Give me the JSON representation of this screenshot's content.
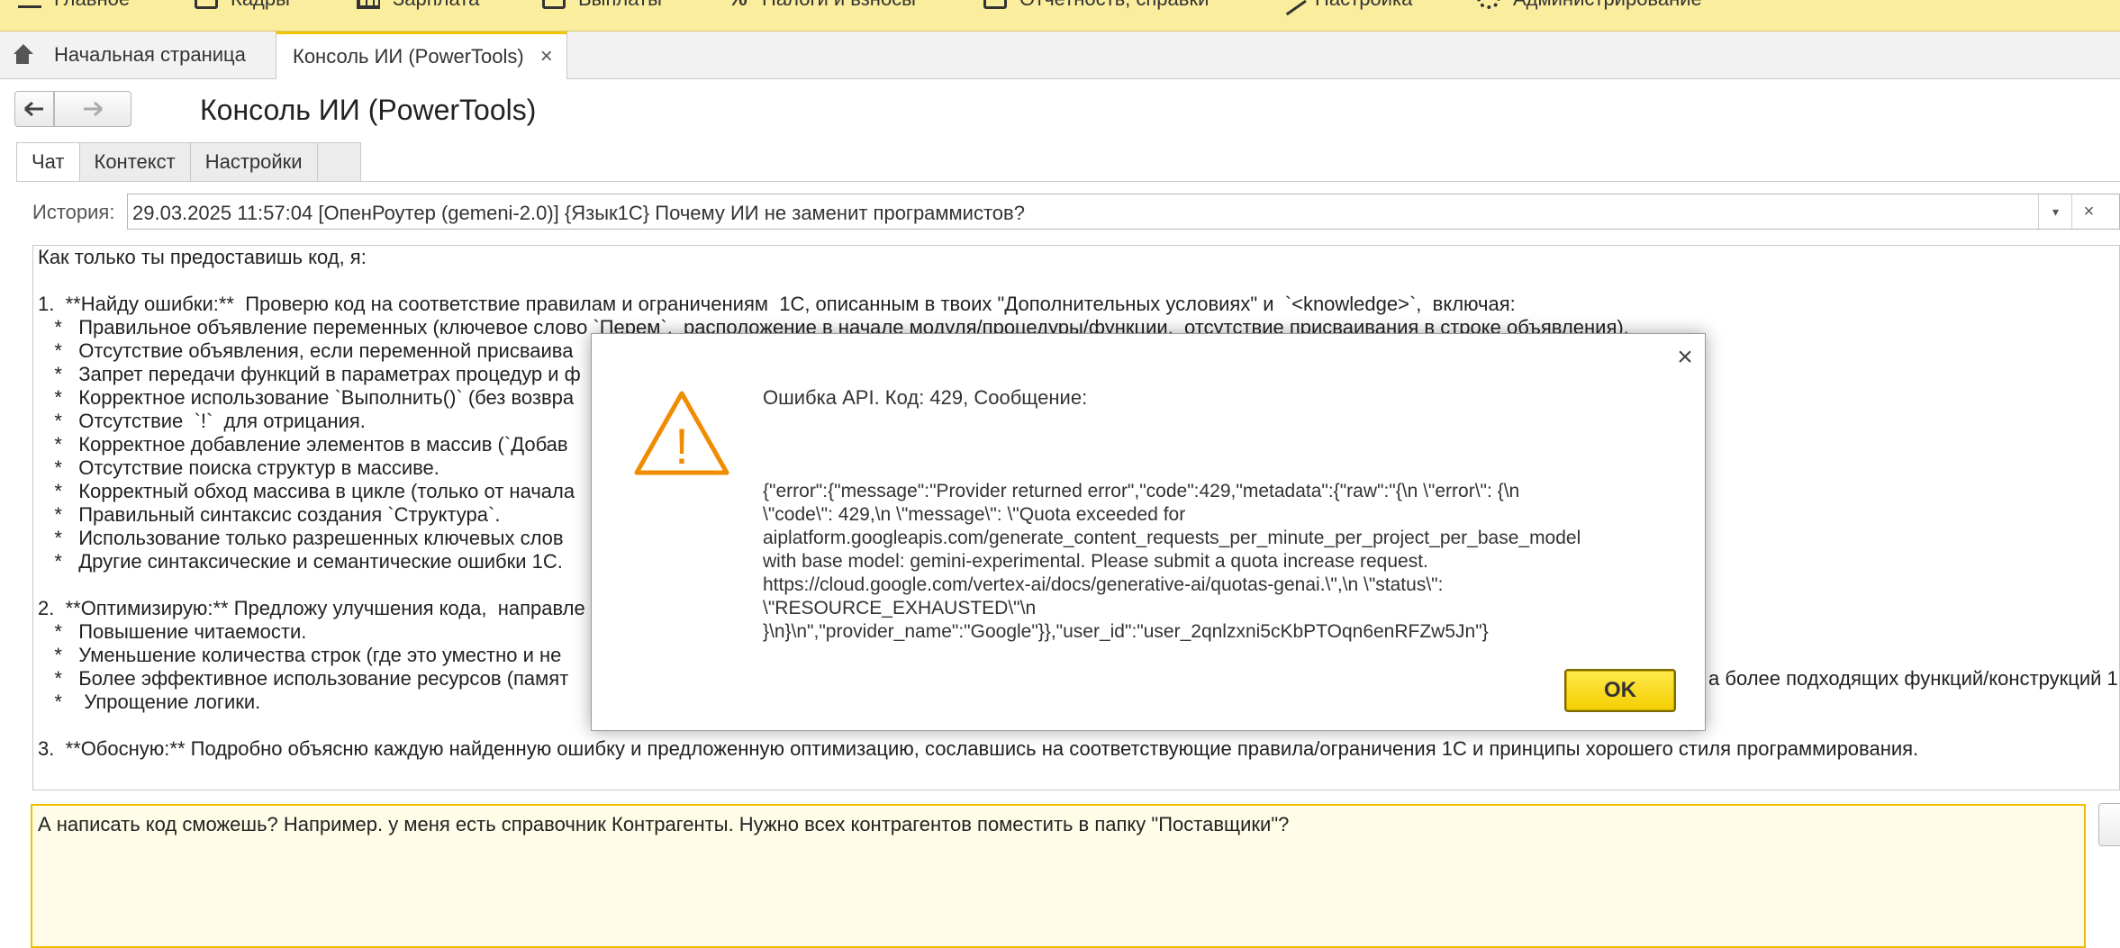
{
  "top_menu": [
    {
      "label": "Главное",
      "icon": "menu-lines-icon"
    },
    {
      "label": "Кадры",
      "icon": "people-icon"
    },
    {
      "label": "Зарплата",
      "icon": "calculator-icon"
    },
    {
      "label": "Выплаты",
      "icon": "wallet-icon"
    },
    {
      "label": "Налоги и взносы",
      "icon": "percent-icon"
    },
    {
      "label": "Отчетность, справки",
      "icon": "report-icon"
    },
    {
      "label": "Настройка",
      "icon": "wrench-icon"
    },
    {
      "label": "Администрирование",
      "icon": "gear-icon"
    }
  ],
  "tabs": {
    "home": "Начальная страница",
    "active": "Консоль ИИ (PowerTools)",
    "close_glyph": "×"
  },
  "header": {
    "back_glyph": "🡐",
    "forward_glyph": "🡒",
    "title": "Консоль ИИ (PowerTools)"
  },
  "form_tabs": [
    "Чат",
    "Контекст",
    "Настройки"
  ],
  "history": {
    "label": "История:",
    "value": "29.03.2025 11:57:04 [ОпенРоутер (gemeni-2.0)] {Язык1С} Почему ИИ не заменит программистов?",
    "dropdown_glyph": "▾",
    "clear_glyph": "×"
  },
  "response_lines": [
    "Как только ты предоставишь код, я:",
    "",
    "1.  **Найду ошибки:**  Проверю код на соответствие правилам и ограничениям  1С, описанным в твоих \"Дополнительных условиях\" и  `<knowledge>`,  включая:",
    "   *   Правильное объявление переменных (ключевое слово `Перем`,  расположение в начале модуля/процедуры/функции,  отсутствие присваивания в строке объявления).",
    "   *   Отсутствие объявления, если переменной присваива",
    "   *   Запрет передачи функций в параметрах процедур и ф",
    "   *   Корректное использование `Выполнить()` (без возвра",
    "   *   Отсутствие  `!`  для отрицания.",
    "   *   Корректное добавление элементов в массив (`Добав",
    "   *   Отсутствие поиска структур в массиве.",
    "   *   Корректный обход массива в цикле (только от начала",
    "   *   Правильный синтаксис создания `Структура`.",
    "   *   Использование только разрешенных ключевых слов",
    "   *   Другие синтаксические и семантические ошибки 1С.",
    "",
    "2.  **Оптимизирую:** Предложу улучшения кода,  направле",
    "   *   Повышение читаемости.",
    "   *   Уменьшение количества строк (где это уместно и не",
    "   *   Более эффективное использование ресурсов (памят",
    "   *    Упрощение логики.",
    "",
    "3.  **Обосную:** Подробно объясню каждую найденную ошибку и предложенную оптимизацию, сославшись на соответствующие правила/ограничения 1С и принципы хорошего стиля программирования."
  ],
  "response_overflow_fragment": "а более подходящих функций/конструкций 1",
  "input": {
    "text": "А написать код сможешь? Например. у меня есть справочник Контрагенты. Нужно всех контрагентов поместить в папку \"Поставщики\"?"
  },
  "dialog": {
    "close_glyph": "×",
    "warning_mark": "!",
    "heading": "Ошибка API. Код: 429, Сообщение:",
    "body_lines": [
      "{\"error\":{\"message\":\"Provider returned error\",\"code\":429,\"metadata\":{\"raw\":\"{\\n  \\\"error\\\": {\\n",
      "\\\"code\\\": 429,\\n    \\\"message\\\": \\\"Quota exceeded for",
      "aiplatform.googleapis.com/generate_content_requests_per_minute_per_project_per_base_model",
      "with base model: gemini-experimental. Please submit a quota increase request.",
      "https://cloud.google.com/vertex-ai/docs/generative-ai/quotas-genai.\\\",\\n    \\\"status\\\":",
      "\\\"RESOURCE_EXHAUSTED\\\"\\n",
      "}\\n}\\n\",\"provider_name\":\"Google\"}},\"user_id\":\"user_2qnlzxni5cKbPTOqn6enRFZw5Jn\"}"
    ],
    "ok_label": "OK"
  },
  "colors": {
    "menu_bar": "#fbed9e",
    "accent_yellow": "#f4cf00",
    "warning_orange": "#f08c00"
  }
}
